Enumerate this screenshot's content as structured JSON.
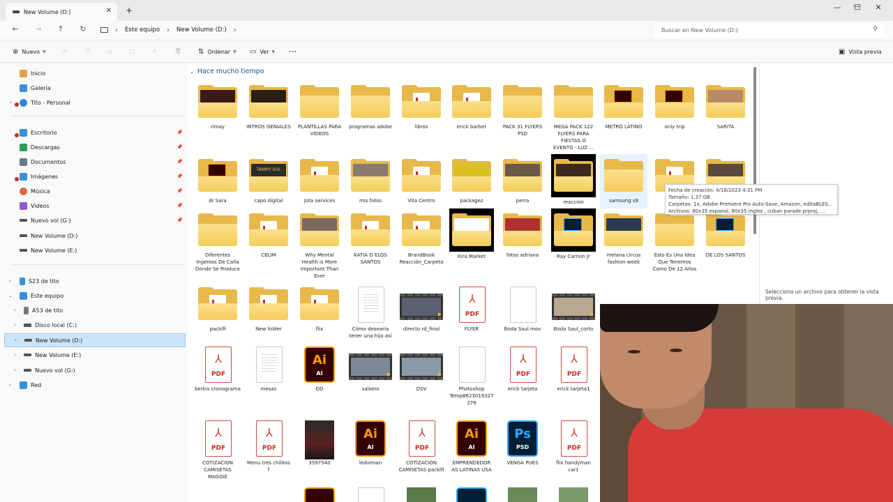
{
  "window": {
    "tab_title": "New Volume (D:)",
    "tab_close": "✕",
    "new_tab": "+",
    "minimize": "—",
    "maximize": "☐",
    "close": "✕"
  },
  "address": {
    "back": "←",
    "forward": "→",
    "up": "↑",
    "refresh": "↻",
    "breadcrumb": [
      "Este equipo",
      "New Volume (D:)"
    ],
    "sep": "›",
    "search_placeholder": "Buscar en New Volume (D:)"
  },
  "commands": {
    "new_label": "Nuevo",
    "sort_label": "Ordenar",
    "view_label": "Ver",
    "more": "···",
    "preview_pane_label": "Vista previa"
  },
  "sidebar": {
    "quick": [
      {
        "label": "Inicio",
        "icon": "home-icon"
      },
      {
        "label": "Galería",
        "icon": "gallery-icon"
      },
      {
        "label": "Tito - Personal",
        "icon": "cloud-icon"
      }
    ],
    "pinned": [
      {
        "label": "Escritorio",
        "icon": "desktop-icon"
      },
      {
        "label": "Descargas",
        "icon": "downloads-icon"
      },
      {
        "label": "Documentos",
        "icon": "documents-icon"
      },
      {
        "label": "Imágenes",
        "icon": "pictures-icon"
      },
      {
        "label": "Música",
        "icon": "music-icon"
      },
      {
        "label": "Videos",
        "icon": "videos-icon"
      },
      {
        "label": "Nuevo vol (G:)",
        "icon": "drive-icon"
      },
      {
        "label": "New Volume (D:)",
        "icon": "drive-icon"
      },
      {
        "label": "New Volume (E:)",
        "icon": "drive-icon"
      }
    ],
    "tree": [
      {
        "label": "S23 de tito",
        "icon": "phone-icon"
      },
      {
        "label": "Este equipo",
        "icon": "pc-icon"
      },
      {
        "label": "A53 de tito",
        "icon": "phone-icon"
      },
      {
        "label": "Disco local (C:)",
        "icon": "drive-icon"
      },
      {
        "label": "New Volume (D:)",
        "icon": "drive-icon"
      },
      {
        "label": "New Volume (E:)",
        "icon": "drive-icon"
      },
      {
        "label": "Nuevo vol (G:)",
        "icon": "drive-icon"
      },
      {
        "label": "Red",
        "icon": "network-icon"
      }
    ]
  },
  "content": {
    "group_header": "Hace mucho tiempo",
    "row1": [
      "rimay",
      "INTROS GENIALES",
      "PLANTILLAS PARA VIDEOS",
      "programas adobe",
      "libros",
      "erick barber",
      "PACK 31 FLYERS PSD",
      "MEGA PACK 122 FLYERS PARA FIESTAS O EVENTO - LUZ ...",
      "METRO LATINO",
      "only trip",
      "SARITA"
    ],
    "row2": [
      "dr Sara",
      "capo digital",
      "Jota services",
      "mis fotos",
      "Vita Centro",
      "packagez",
      "perra",
      "reaccion",
      "samsung s9"
    ],
    "row3": [
      "Diferentes Ingenios De Caña Donde Se Produce",
      "CELIM",
      "Why Mental Health is More Important Than Ever",
      "KATIA D ELOS SANTOS",
      "BrandBook Reacción_Carpeta",
      "Kira.Market",
      "fotos adriana",
      "Ray Carrion Jr",
      "melana circus fashion week",
      "Esto Es Una Idea Que Tenemos Como De 12 Años",
      "DE LOS SANTOS"
    ],
    "row4": [
      "packifi",
      "New folder",
      "flix",
      "Cómo desearía tener una hija así",
      "directo rd_final",
      "FLYER",
      "Boda Saul.mov",
      "Boda Saul_corto"
    ],
    "row5": [
      "berkis cronograma",
      "mesas",
      "DD",
      "salsero",
      "DSV",
      "Photoshop Temp8623019327276",
      "erick tarjeta",
      "erick tarjeta1"
    ],
    "row6": [
      "COTIZACION CAMISETAS MAGGIE",
      "Menu tres chilitos f",
      "3597540",
      "ledviman",
      "COTIZACION CAMISETAS packifi",
      "EMPRENDEDOR AS LATINAS USA",
      "VENGA PUES",
      "flix handyman car1"
    ],
    "pdf_text": "PDF",
    "ai_text": "Ai",
    "ai_small": "AI",
    "ps_text": "Ps",
    "psd_small": "PSD",
    "folder_thumb_capo": "TAMMY SOL"
  },
  "tooltip": {
    "created": "Fecha de creación: 4/18/2023 4:31 PM",
    "size": "Tamaño: 1,37 GB",
    "folders": "Carpetas: 1x, Adobe Premiere Pro Auto-Save, Amazon, editaBLES, ...",
    "files": "Archivos: 80x35 espanol, 80x35 ingles , cuban parade.prproj, ..."
  },
  "preview": {
    "hint": "Selecciona un archivo para obtener la vista previa."
  },
  "colors": {
    "accent": "#0067c0",
    "folder": "#f5cc5a",
    "pdf": "#c42b1c",
    "ai": "#ff9a00",
    "ps": "#31a8ff",
    "selection": "#cce4f7"
  }
}
